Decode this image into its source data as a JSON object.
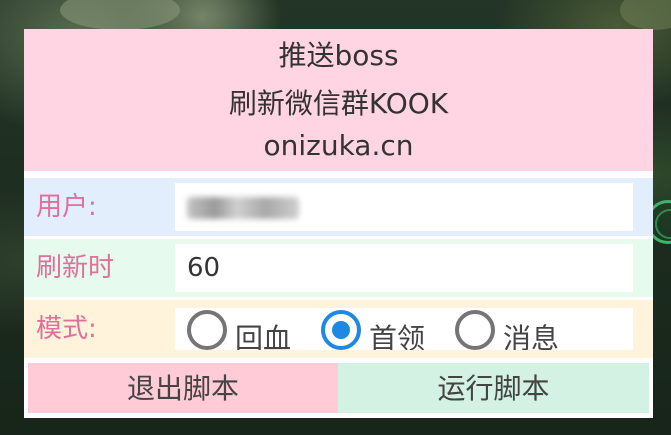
{
  "header": {
    "title": "推送boss",
    "subtitle": "刷新微信群KOOK",
    "site": "onizuka.cn"
  },
  "form": {
    "user": {
      "label": "用户:",
      "value_obscured": true
    },
    "refresh": {
      "label": "刷新时",
      "value": "60"
    },
    "mode": {
      "label": "模式:",
      "options": [
        {
          "label": "回血",
          "checked": false
        },
        {
          "label": "首领",
          "checked": true
        },
        {
          "label": "消息",
          "checked": false
        }
      ]
    }
  },
  "buttons": {
    "exit_label": "退出脚本",
    "run_label": "运行脚本"
  },
  "colors": {
    "header_bg": "#ffd4e3",
    "label_color": "#e06f9b",
    "radio_selected": "#1e88e5",
    "exit_bg": "#ffcbd6",
    "run_bg": "#d3f2e3"
  }
}
